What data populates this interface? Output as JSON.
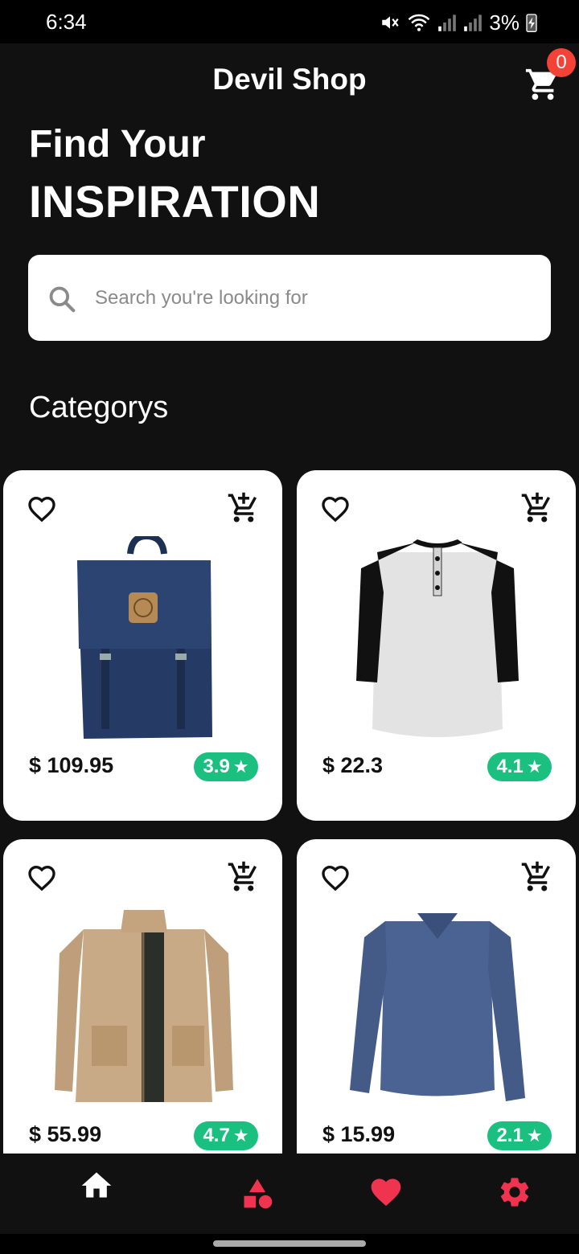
{
  "status_bar": {
    "time": "6:34",
    "battery": "3%"
  },
  "app_bar": {
    "title": "Devil Shop",
    "cart_count": "0"
  },
  "headline": {
    "line1": "Find Your",
    "line2": "INSPIRATION"
  },
  "search": {
    "placeholder": "Search you're looking for"
  },
  "section": {
    "title": "Categorys"
  },
  "products": [
    {
      "price": "$ 109.95",
      "rating": "3.9",
      "image": "backpack"
    },
    {
      "price": "$ 22.3",
      "rating": "4.1",
      "image": "henley-shirt"
    },
    {
      "price": "$ 55.99",
      "rating": "4.7",
      "image": "jacket"
    },
    {
      "price": "$ 15.99",
      "rating": "2.1",
      "image": "long-sleeve-tee"
    }
  ],
  "bottom_nav": {
    "items": [
      {
        "name": "home",
        "icon": "home-icon",
        "color": "#ffffff"
      },
      {
        "name": "categories",
        "icon": "shapes-icon",
        "color": "#f0344f"
      },
      {
        "name": "favorites",
        "icon": "heart-icon",
        "color": "#f0344f"
      },
      {
        "name": "settings",
        "icon": "gear-icon",
        "color": "#f0344f"
      }
    ]
  },
  "colors": {
    "accent": "#f0344f",
    "rating": "#1bbf7f",
    "badge": "#f44336",
    "background": "#111112"
  }
}
